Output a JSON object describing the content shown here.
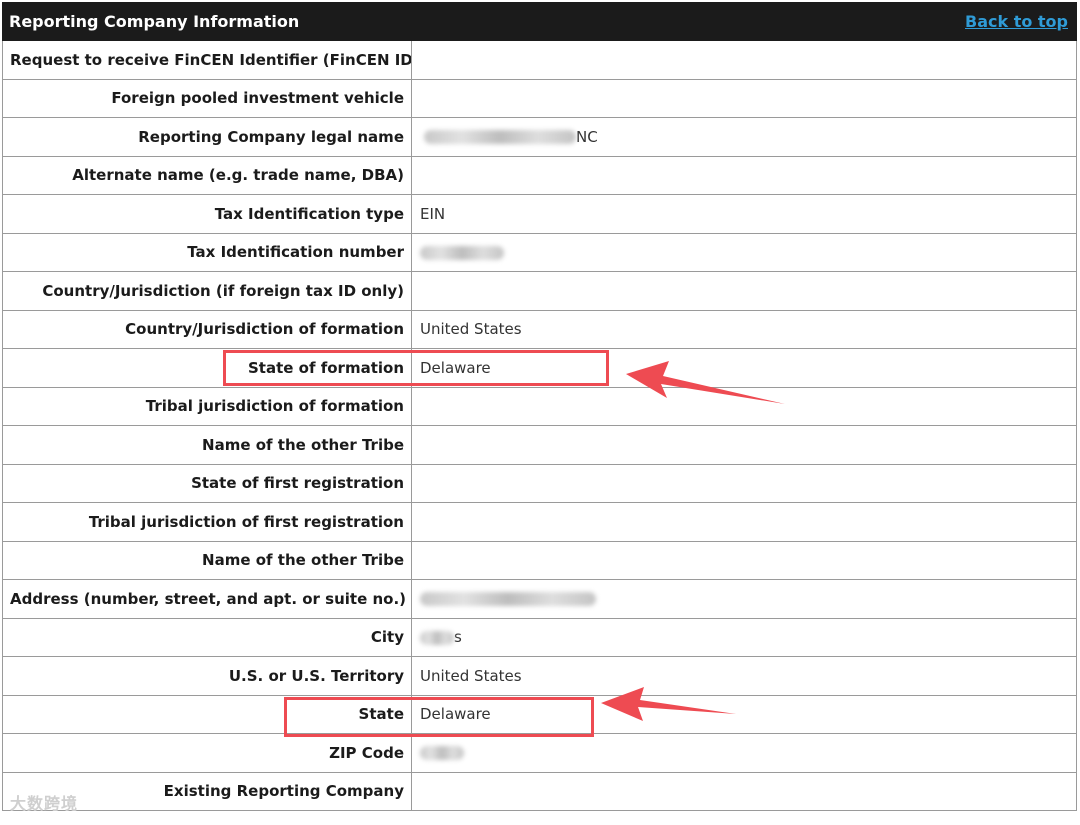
{
  "header": {
    "title": "Reporting Company Information",
    "back_to_top": "Back to top"
  },
  "rows": [
    {
      "label": "Request to receive FinCEN Identifier (FinCEN ID)",
      "value": ""
    },
    {
      "label": "Foreign pooled investment vehicle",
      "value": ""
    },
    {
      "label": "Reporting Company legal name",
      "value": "NC"
    },
    {
      "label": "Alternate name (e.g. trade name, DBA)",
      "value": ""
    },
    {
      "label": "Tax Identification type",
      "value": "EIN"
    },
    {
      "label": "Tax Identification number",
      "value": ""
    },
    {
      "label": "Country/Jurisdiction (if foreign tax ID only)",
      "value": ""
    },
    {
      "label": "Country/Jurisdiction of formation",
      "value": "United States"
    },
    {
      "label": "State of formation",
      "value": "Delaware"
    },
    {
      "label": "Tribal jurisdiction of formation",
      "value": ""
    },
    {
      "label": "Name of the other Tribe",
      "value": ""
    },
    {
      "label": "State of first registration",
      "value": ""
    },
    {
      "label": "Tribal jurisdiction of first registration",
      "value": ""
    },
    {
      "label": "Name of the other Tribe",
      "value": ""
    },
    {
      "label": "Address (number, street, and apt. or suite no.)",
      "value": ""
    },
    {
      "label": "City",
      "value": "s"
    },
    {
      "label": "U.S. or U.S. Territory",
      "value": "United States"
    },
    {
      "label": "State",
      "value": "Delaware"
    },
    {
      "label": "ZIP Code",
      "value": ""
    },
    {
      "label": "Existing Reporting Company",
      "value": ""
    }
  ],
  "watermark": "大数跨境",
  "colors": {
    "header_bg": "#1b1b1b",
    "link": "#2f9bd6",
    "highlight": "#ee4b52"
  }
}
